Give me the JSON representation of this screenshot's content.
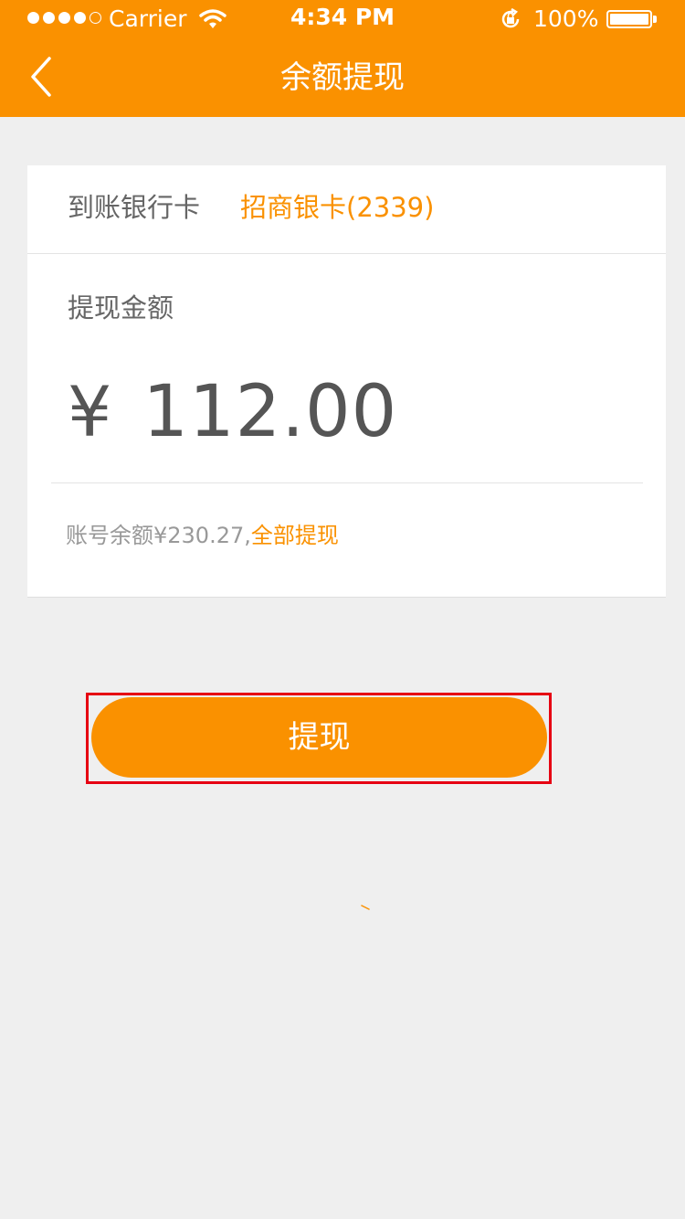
{
  "status_bar": {
    "carrier": "Carrier",
    "time": "4:34 PM",
    "battery": "100%"
  },
  "nav": {
    "title": "余额提现",
    "back_icon": "chevron-left-icon"
  },
  "bank": {
    "label": "到账银行卡",
    "value": "招商银卡(2339)"
  },
  "amount": {
    "label": "提现金额",
    "currency": "¥",
    "value": "112.00"
  },
  "balance": {
    "text": "账号余额¥230.27,",
    "action": "全部提现"
  },
  "submit": {
    "label": "提现"
  },
  "colors": {
    "accent": "#fa9100",
    "highlight": "#e60012",
    "background": "#efefef"
  }
}
